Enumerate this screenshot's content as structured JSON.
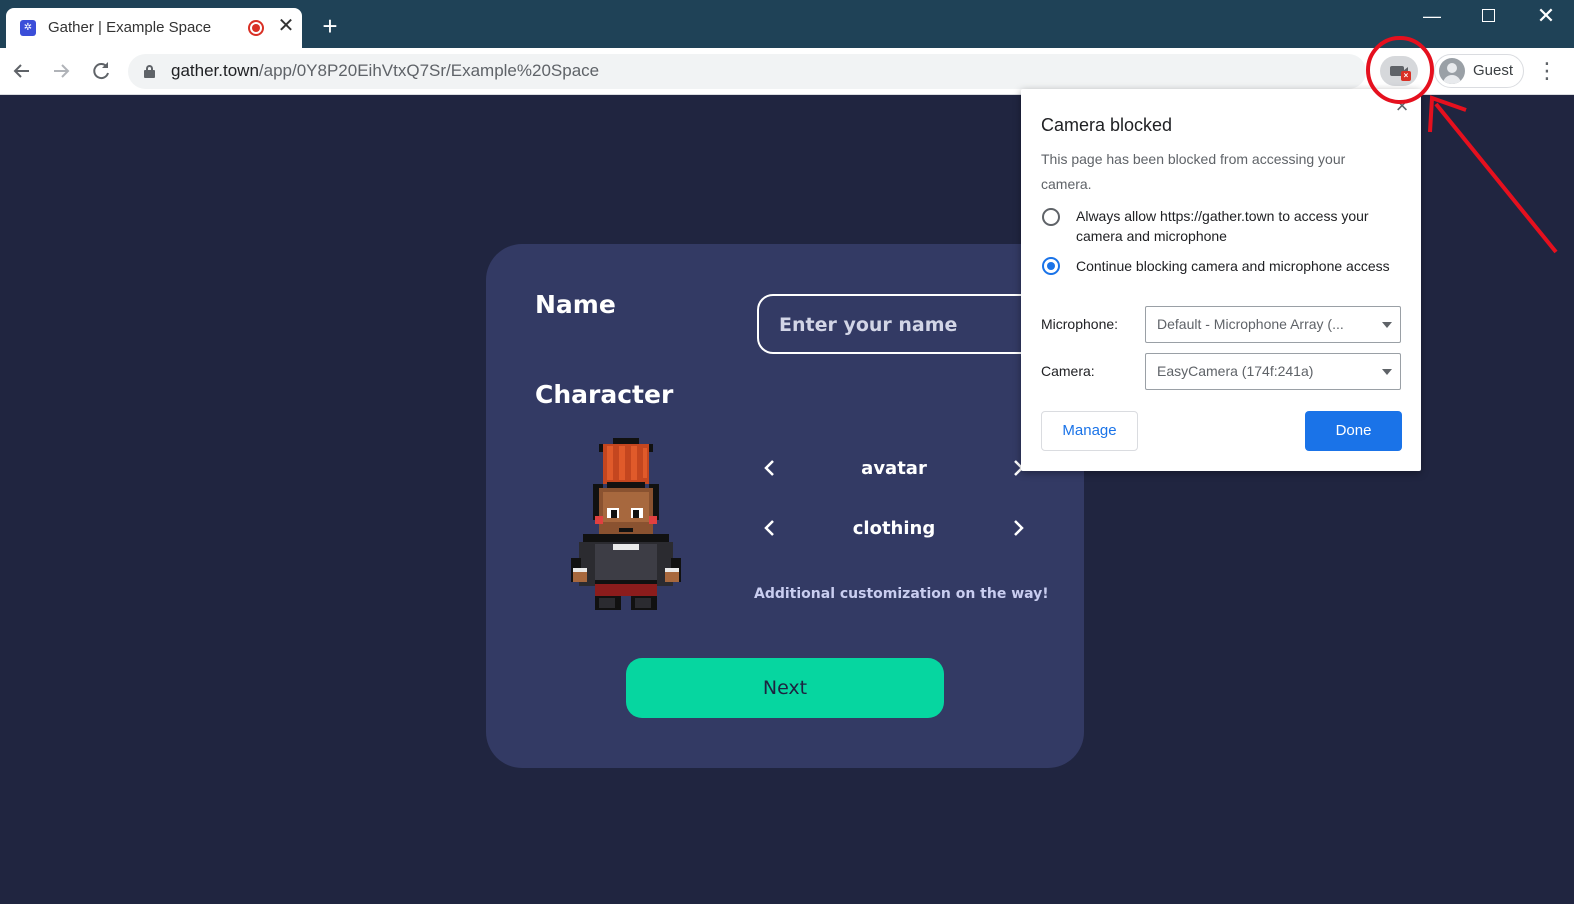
{
  "browser": {
    "tab": {
      "title": "Gather | Example Space",
      "favicon_icon": "gather-favicon-icon",
      "close_symbol": "✕"
    },
    "new_tab_symbol": "+",
    "window_controls": {
      "minimize": "—",
      "close": "✕"
    },
    "url": {
      "host": "gather.town",
      "path": "/app/0Y8P20EihVtxQ7Sr/Example%20Space"
    },
    "profile_label": "Guest",
    "menu_symbol": "⋮"
  },
  "page": {
    "name_label": "Name",
    "name_placeholder": "Enter your name",
    "character_label": "Character",
    "options": [
      {
        "label": "avatar"
      },
      {
        "label": "clothing"
      }
    ],
    "hint": "Additional customization on the way!",
    "next_button": "Next"
  },
  "permission_bubble": {
    "title": "Camera blocked",
    "description": "This page has been blocked from accessing your camera.",
    "radio_options": [
      {
        "label": "Always allow https://gather.town to access your camera and microphone",
        "checked": false
      },
      {
        "label": "Continue blocking camera and microphone access",
        "checked": true
      }
    ],
    "microphone_label": "Microphone:",
    "microphone_value": "Default - Microphone Array (...",
    "camera_label": "Camera:",
    "camera_value": "EasyCamera (174f:241a)",
    "manage_button": "Manage",
    "done_button": "Done"
  },
  "colors": {
    "page_background": "#202540",
    "card_background": "#333a64",
    "next_button": "#06d6a0",
    "chrome_titlebar": "#1f4257",
    "done_button": "#1a73e8",
    "annotation": "#e5101e"
  }
}
